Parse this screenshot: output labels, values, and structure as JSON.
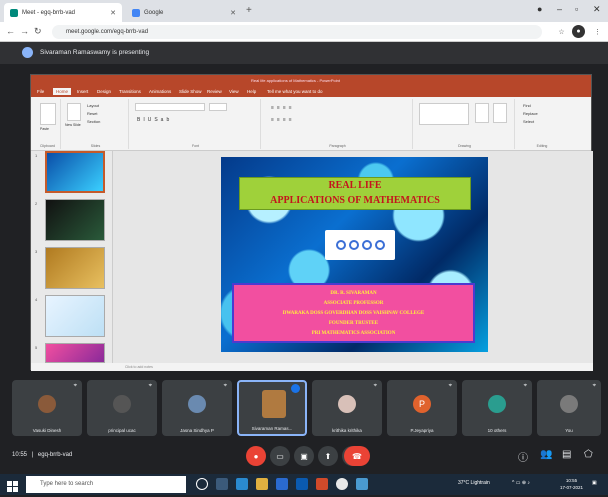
{
  "browser": {
    "tabs": [
      {
        "label": "Meet - egq-brrb-vad",
        "active": true
      },
      {
        "label": "Google",
        "active": false
      }
    ],
    "new_tab": "+",
    "url": "meet.google.com/egq-brrb-vad"
  },
  "meet": {
    "presenting_label": "Sivaraman Ramaswamy is presenting",
    "meeting_time": "10:55",
    "meeting_code": "egq-brrb-vad",
    "participants": [
      {
        "name": "Vasuki Dinesh",
        "avatar_color": "#8a5a3a"
      },
      {
        "name": "principal ucac",
        "avatar_color": "#555555"
      },
      {
        "name": "Jasna Sindhya P",
        "avatar_color": "#6a8ab0"
      },
      {
        "name": "Sivaraman Ramas...",
        "avatar_color": "#b07a40",
        "active": true
      },
      {
        "name": "krithika krithika",
        "avatar_color": "#d8c0b8"
      },
      {
        "name": "P.Jeyapriya",
        "avatar_color": "#e0622d",
        "initial": "P"
      },
      {
        "name": "10 others",
        "avatar_color": "#2a9d8f"
      },
      {
        "name": "You",
        "avatar_color": "#7a7a7a"
      }
    ]
  },
  "powerpoint": {
    "title": "Real life applications of Mathematics - PowerPoint",
    "menu": [
      "File",
      "Home",
      "Insert",
      "Design",
      "Transitions",
      "Animations",
      "Slide Show",
      "Review",
      "View",
      "Help",
      "Tell me what you want to do"
    ],
    "ribbon_groups": [
      "Clipboard",
      "Slides",
      "Font",
      "Paragraph",
      "Drawing",
      "Editing"
    ],
    "ribbon_buttons": {
      "paste": "Paste",
      "new_slide": "New Slide",
      "layout": "Layout",
      "reset": "Reset",
      "section": "Section",
      "find": "Find",
      "replace": "Replace",
      "select": "Select"
    },
    "notes_placeholder": "Click to add notes",
    "slide_numbers": [
      "1",
      "2",
      "3",
      "4",
      "5"
    ],
    "slide": {
      "title_line1": "REAL LIFE",
      "title_line2": "APPLICATIONS OF MATHEMATICS",
      "author_lines": [
        "DR. R. SIVARAMAN",
        "ASSOCIATE PROFESSOR",
        "DWARAKA DOSS GOVERDHAN DOSS VAISHNAV COLLEGE",
        "FOUNDER TRUSTEE",
        "PRI MATHEMATICS ASSOCIATION"
      ]
    }
  },
  "taskbar": {
    "search_placeholder": "Type here to search",
    "weather": "37°C Lightrain",
    "time": "10:55",
    "date": "17-07-2021"
  }
}
